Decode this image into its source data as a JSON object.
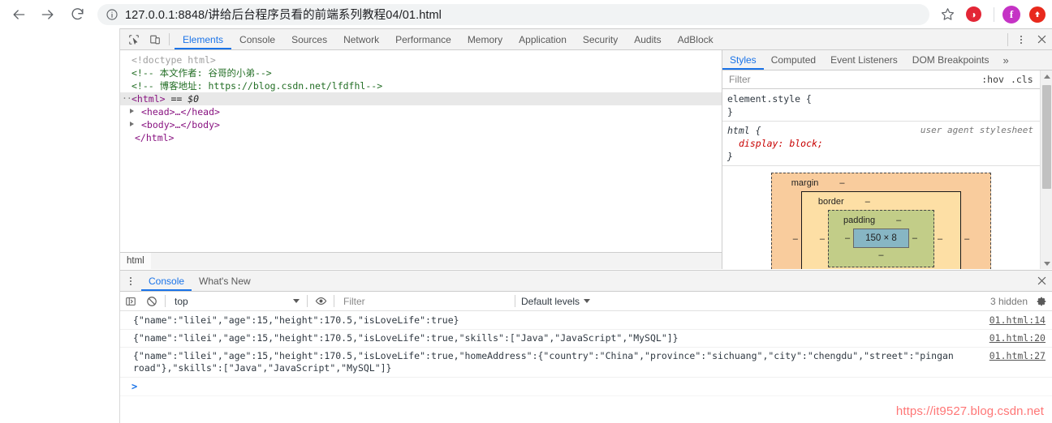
{
  "browser": {
    "back_icon": "arrow-left-icon",
    "forward_icon": "arrow-right-icon",
    "reload_icon": "reload-icon",
    "info_icon": "info-circle-icon",
    "url": "127.0.0.1:8848/讲给后台程序员看的前端系列教程04/01.html",
    "bookmark_icon": "star-icon",
    "extensions": [
      {
        "name": "opera-extension-icon",
        "glyph": "◑",
        "color": "#e32636"
      },
      {
        "name": "facebook-extension-icon",
        "glyph": "f",
        "color": "#c533c5"
      },
      {
        "name": "upload-extension-icon",
        "glyph": "↑",
        "color": "#e8291c"
      }
    ]
  },
  "devtools": {
    "inspect_icon": "inspect-element-icon",
    "device_icon": "device-toolbar-icon",
    "tabs": [
      {
        "label": "Elements",
        "active": true
      },
      {
        "label": "Console",
        "active": false
      },
      {
        "label": "Sources",
        "active": false
      },
      {
        "label": "Network",
        "active": false
      },
      {
        "label": "Performance",
        "active": false
      },
      {
        "label": "Memory",
        "active": false
      },
      {
        "label": "Application",
        "active": false
      },
      {
        "label": "Security",
        "active": false
      },
      {
        "label": "Audits",
        "active": false
      },
      {
        "label": "AdBlock",
        "active": false
      }
    ],
    "more_icon": "kebab-menu-icon",
    "close_icon": "close-icon",
    "dom": {
      "lines": [
        {
          "type": "doctype",
          "text": "<!doctype html>"
        },
        {
          "type": "comment",
          "text": "<!-- 本文作者: 谷哥的小弟-->"
        },
        {
          "type": "comment_url",
          "prefix": "<!-- 博客地址: ",
          "url": "https://blog.csdn.net/lfdfhl",
          "suffix": "-->"
        },
        {
          "type": "selected",
          "text": "<html>",
          "marker": "== $0"
        },
        {
          "type": "collapsed",
          "text": "<head>…</head>"
        },
        {
          "type": "collapsed",
          "text": "<body>…</body>"
        },
        {
          "type": "close",
          "text": "</html>"
        }
      ]
    },
    "breadcrumb": "html"
  },
  "styles": {
    "tabs": [
      {
        "label": "Styles",
        "active": true
      },
      {
        "label": "Computed",
        "active": false
      },
      {
        "label": "Event Listeners",
        "active": false
      },
      {
        "label": "DOM Breakpoints",
        "active": false
      }
    ],
    "overflow_icon": "chevron-double-right-icon",
    "filter_placeholder": "Filter",
    "hov_label": ":hov",
    "cls_label": ".cls",
    "add_rule_icon": "plus-icon",
    "rules": [
      {
        "selector": "element.style {",
        "origin": "",
        "props": [],
        "close": "}"
      },
      {
        "selector": "html {",
        "origin": "user agent stylesheet",
        "props": [
          {
            "name": "display",
            "value": "block;"
          }
        ],
        "close": "}"
      }
    ],
    "box_model": {
      "margin_label": "margin",
      "margin_value": "–",
      "border_label": "border",
      "border_value": "–",
      "padding_label": "padding",
      "padding_value": "–",
      "content_size": "150 × 8",
      "dash": "–",
      "colors": {
        "margin": "#f9cc9d",
        "border": "#fddfa5",
        "padding": "#c2cd88",
        "content": "#87b6c4"
      }
    }
  },
  "drawer": {
    "menu_icon": "kebab-menu-icon",
    "tabs": [
      {
        "label": "Console",
        "active": true
      },
      {
        "label": "What's New",
        "active": false
      }
    ],
    "close_icon": "close-icon",
    "toolbar": {
      "sidebar_icon": "show-console-sidebar-icon",
      "clear_icon": "clear-console-icon",
      "context": "top",
      "eye_icon": "live-expression-icon",
      "filter_placeholder": "Filter",
      "levels_label": "Default levels",
      "hidden_label": "3 hidden",
      "settings_icon": "gear-icon"
    },
    "logs": [
      {
        "message": "{\"name\":\"lilei\",\"age\":15,\"height\":170.5,\"isLoveLife\":true}",
        "source": "01.html:14"
      },
      {
        "message": "{\"name\":\"lilei\",\"age\":15,\"height\":170.5,\"isLoveLife\":true,\"skills\":[\"Java\",\"JavaScript\",\"MySQL\"]}",
        "source": "01.html:20"
      },
      {
        "message": "{\"name\":\"lilei\",\"age\":15,\"height\":170.5,\"isLoveLife\":true,\"homeAddress\":{\"country\":\"China\",\"province\":\"sichuang\",\"city\":\"chengdu\",\"street\":\"pingan road\"},\"skills\":[\"Java\",\"JavaScript\",\"MySQL\"]}",
        "source": "01.html:27"
      }
    ],
    "prompt": ">"
  },
  "watermark": "https://it9527.blog.csdn.net"
}
